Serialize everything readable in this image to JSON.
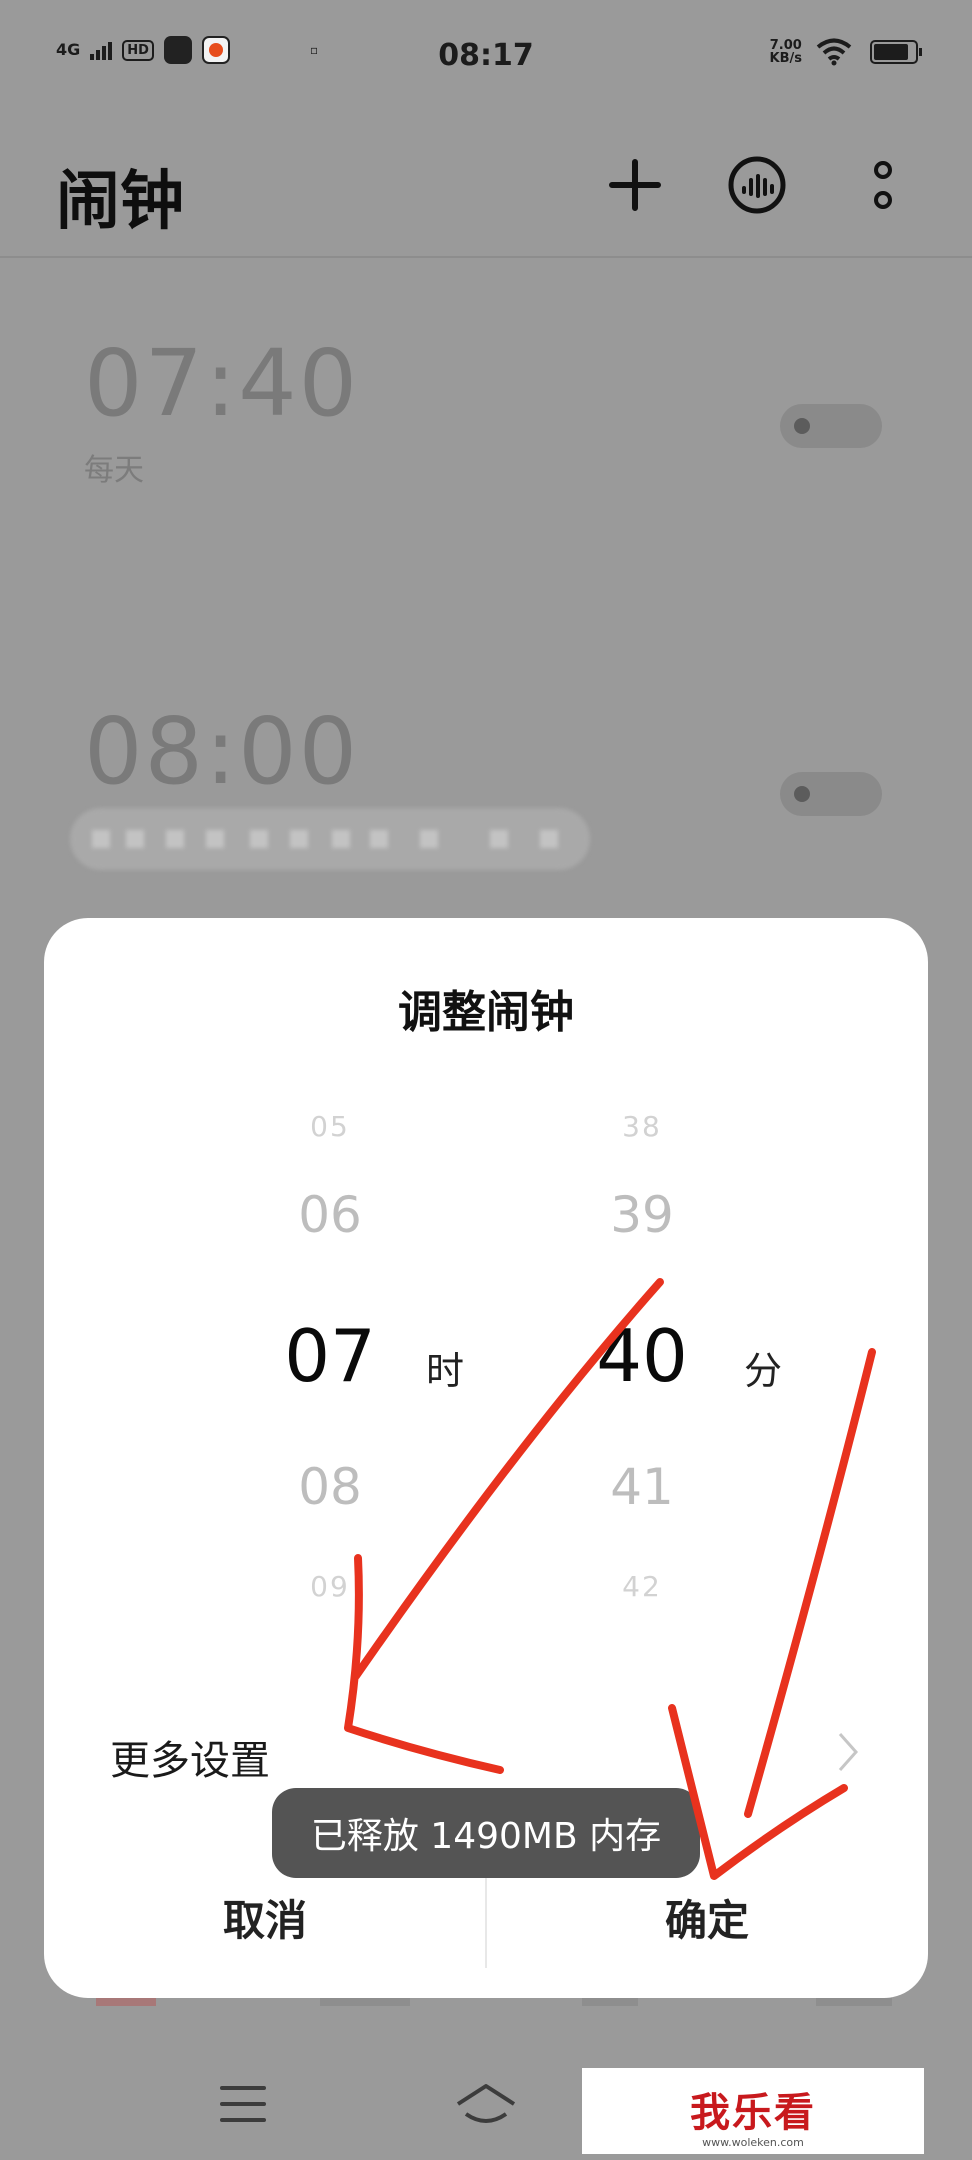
{
  "status_bar": {
    "network": "4G",
    "hd": "HD",
    "time": "08:17",
    "speed_value": "7.00",
    "speed_unit": "KB/s"
  },
  "header": {
    "title": "闹钟",
    "icons": [
      "add-icon",
      "voice-icon",
      "more-icon"
    ]
  },
  "alarms": [
    {
      "time": "07:40",
      "repeat": "每天",
      "enabled": false
    },
    {
      "time": "08:00",
      "repeat": "",
      "enabled": false
    }
  ],
  "dialog": {
    "title": "调整闹钟",
    "hours": {
      "far_above": "05",
      "above": "06",
      "selected": "07",
      "below": "08",
      "far_below": "09",
      "unit": "时"
    },
    "minutes": {
      "far_above": "38",
      "above": "39",
      "selected": "40",
      "below": "41",
      "far_below": "42",
      "unit": "分"
    },
    "more_settings": "更多设置",
    "cancel": "取消",
    "confirm": "确定"
  },
  "toast": "已释放 1490MB 内存",
  "watermark": {
    "main": "我乐看",
    "sub": "www.woleken.com"
  },
  "colors": {
    "annotation": "#e8321e",
    "overlay": "#9a9a9a",
    "dialog": "#ffffff"
  }
}
